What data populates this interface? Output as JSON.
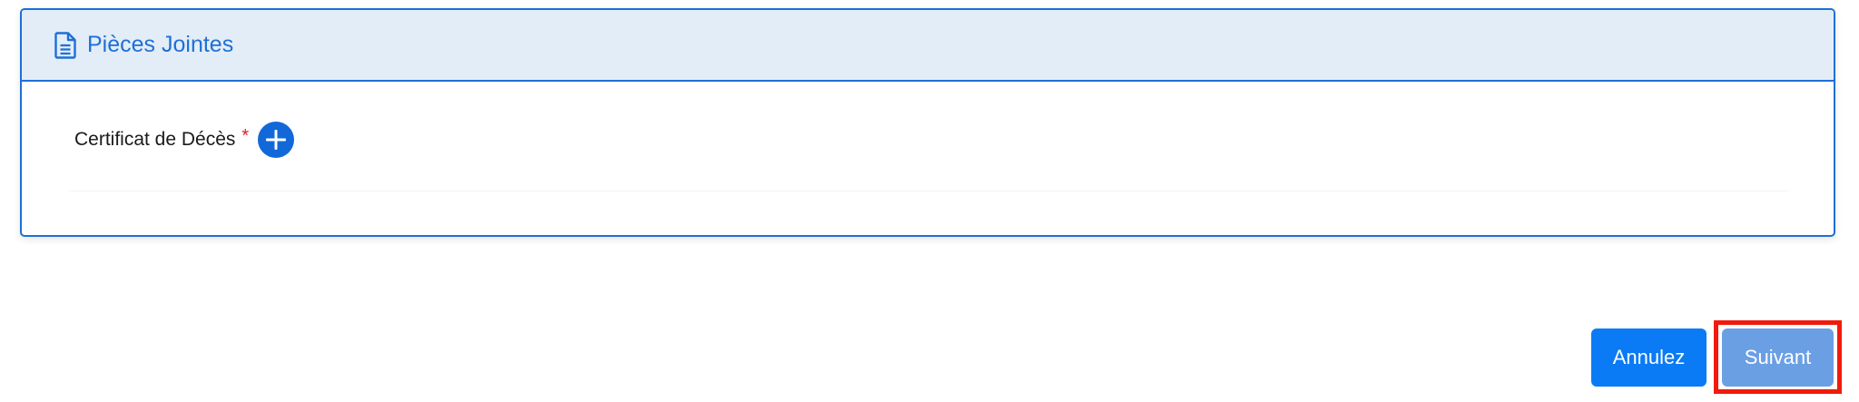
{
  "attachments": {
    "title": "Pièces Jointes",
    "header_icon": "document-icon",
    "fields": [
      {
        "label": "Certificat de Décès",
        "required_marker": "*",
        "action_icon": "plus-circle-icon"
      }
    ]
  },
  "actions": {
    "cancel_label": "Annulez",
    "next_label": "Suivant"
  },
  "colors": {
    "primary": "#1f6fd6",
    "header_bg": "#e2edf8",
    "cancel_button": "#0a7bf5",
    "next_button": "#6a9fe4",
    "required": "#e0192d",
    "highlight_frame": "#f21a0c"
  }
}
